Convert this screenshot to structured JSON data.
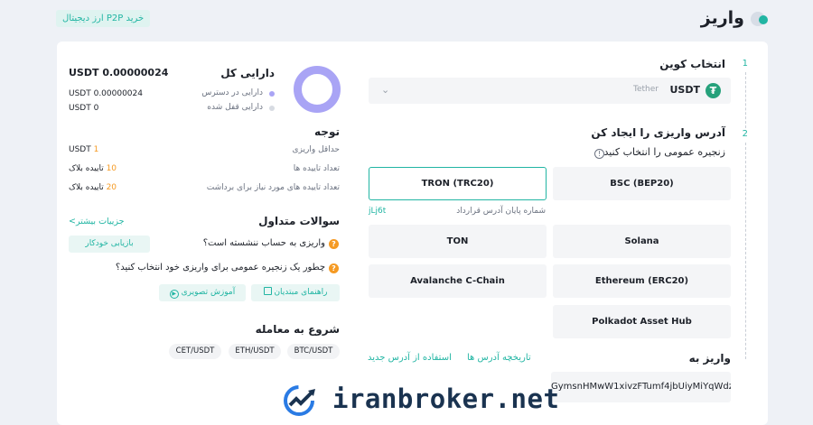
{
  "header": {
    "title": "واریز",
    "p2p_button": "خرید P2P ارز دیجیتال"
  },
  "steps": {
    "step1": {
      "number": "1",
      "title": "انتخاب کوین"
    },
    "step2": {
      "number": "2",
      "title": "آدرس واریزی را ایجاد کن",
      "subtitle": "زنجیره عمومی را انتخاب کنید"
    }
  },
  "coin": {
    "symbol": "USDT",
    "name": "Tether",
    "icon": "tether-icon"
  },
  "networks": [
    "TRON (TRC20)",
    "BSC (BEP20)",
    "TON",
    "Solana",
    "Avalanche C-Chain",
    "Ethereum (ERC20)",
    "Polkadot Asset Hub"
  ],
  "contract": {
    "label": "شماره پایان آدرس قرارداد",
    "value": "jLj6t"
  },
  "deposit_to": {
    "title": "واریز به",
    "address": "GymsnHMwW1xivzFTumf4jbUiyMiYqWdz",
    "history_link": "تاریخچه آدرس ها",
    "new_address_link": "استفاده از آدرس جدید"
  },
  "assets": {
    "title": "دارایی کل",
    "total": "USDT 0.00000024",
    "available_label": "دارایی در دسترس",
    "available_value": "USDT 0.00000024",
    "locked_label": "دارایی قفل شده",
    "locked_value": "USDT 0",
    "colors": {
      "available": "#a9a4f5",
      "locked": "#d7dbe2"
    }
  },
  "notice": {
    "title": "توجه",
    "rows": [
      {
        "label": "حداقل واریزی",
        "value_num": "1",
        "value_unit": "USDT"
      },
      {
        "label": "تعداد تاییده ها",
        "value_num": "10",
        "value_unit": "تاییده بلاک"
      },
      {
        "label": "تعداد تاییده های مورد نیاز برای برداشت",
        "value_num": "20",
        "value_unit": "تاییده بلاک"
      }
    ]
  },
  "faq": {
    "title": "سوالات متداول",
    "more_link": "جزییات بیشتر>",
    "q1": "واریزی به حساب ننشسته است؟",
    "q1_button": "بازیابی خودکار",
    "q2": "چطور یک زنجیره عمومی برای واریزی خود انتخاب کنید؟",
    "guide_button": "راهنمای مبتدیان",
    "video_button": "آموزش تصویری"
  },
  "trade": {
    "title": "شروع به معامله",
    "pairs": [
      "BTC/USDT",
      "ETH/USDT",
      "CET/USDT"
    ]
  },
  "watermark": "iranbroker.net",
  "theme": {
    "accent": "#21b5a3",
    "warning": "#f59a23"
  }
}
